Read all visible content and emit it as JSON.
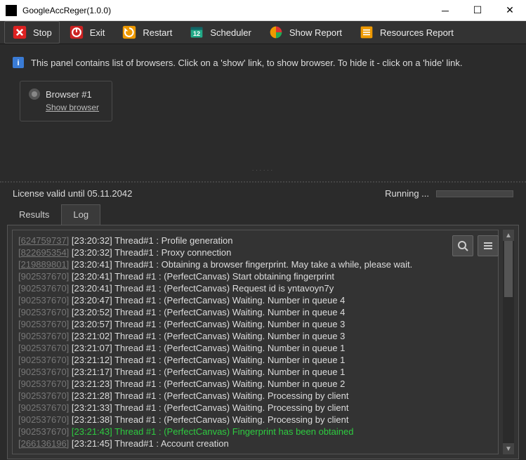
{
  "window": {
    "title": "GoogleAccReger(1.0.0)"
  },
  "toolbar": {
    "stop": "Stop",
    "exit": "Exit",
    "restart": "Restart",
    "scheduler": "Scheduler",
    "show_report": "Show Report",
    "resources_report": "Resources Report"
  },
  "panel": {
    "info": "This panel contains list of browsers. Click on a 'show' link, to show browser. To hide it - click on a 'hide' link.",
    "browser_name": "Browser #1",
    "show_link": "Show browser"
  },
  "status": {
    "license": "License valid until 05.11.2042",
    "running": "Running ..."
  },
  "tabs": {
    "results": "Results",
    "log": "Log"
  },
  "log": [
    {
      "id": "624759737",
      "u": true,
      "g": false,
      "t": "[23:20:32] Thread#1 : Profile generation"
    },
    {
      "id": "822695354",
      "u": true,
      "g": false,
      "t": "[23:20:32] Thread#1 : Proxy connection"
    },
    {
      "id": "219889801",
      "u": true,
      "g": false,
      "t": "[23:20:41] Thread#1 : Obtaining a browser fingerprint. May take a while, please wait."
    },
    {
      "id": "902537670",
      "u": false,
      "g": false,
      "t": "[23:20:41] Thread #1 : (PerfectCanvas) Start obtaining fingerprint"
    },
    {
      "id": "902537670",
      "u": false,
      "g": false,
      "t": "[23:20:41] Thread #1 : (PerfectCanvas) Request id is yntavoyn7y"
    },
    {
      "id": "902537670",
      "u": false,
      "g": false,
      "t": "[23:20:47] Thread #1 : (PerfectCanvas) Waiting. Number in queue 4"
    },
    {
      "id": "902537670",
      "u": false,
      "g": false,
      "t": "[23:20:52] Thread #1 : (PerfectCanvas) Waiting. Number in queue 4"
    },
    {
      "id": "902537670",
      "u": false,
      "g": false,
      "t": "[23:20:57] Thread #1 : (PerfectCanvas) Waiting. Number in queue 3"
    },
    {
      "id": "902537670",
      "u": false,
      "g": false,
      "t": "[23:21:02] Thread #1 : (PerfectCanvas) Waiting. Number in queue 3"
    },
    {
      "id": "902537670",
      "u": false,
      "g": false,
      "t": "[23:21:07] Thread #1 : (PerfectCanvas) Waiting. Number in queue 1"
    },
    {
      "id": "902537670",
      "u": false,
      "g": false,
      "t": "[23:21:12] Thread #1 : (PerfectCanvas) Waiting. Number in queue 1"
    },
    {
      "id": "902537670",
      "u": false,
      "g": false,
      "t": "[23:21:17] Thread #1 : (PerfectCanvas) Waiting. Number in queue 1"
    },
    {
      "id": "902537670",
      "u": false,
      "g": false,
      "t": "[23:21:23] Thread #1 : (PerfectCanvas) Waiting. Number in queue 2"
    },
    {
      "id": "902537670",
      "u": false,
      "g": false,
      "t": "[23:21:28] Thread #1 : (PerfectCanvas) Waiting. Processing by client"
    },
    {
      "id": "902537670",
      "u": false,
      "g": false,
      "t": "[23:21:33] Thread #1 : (PerfectCanvas) Waiting. Processing by client"
    },
    {
      "id": "902537670",
      "u": false,
      "g": false,
      "t": "[23:21:38] Thread #1 : (PerfectCanvas) Waiting. Processing by client"
    },
    {
      "id": "902537670",
      "u": false,
      "g": true,
      "t": "[23:21:43] Thread #1 : (PerfectCanvas) Fingerprint has been obtained"
    },
    {
      "id": "266136196",
      "u": true,
      "g": false,
      "t": "[23:21:45] Thread#1 : Account creation"
    }
  ]
}
